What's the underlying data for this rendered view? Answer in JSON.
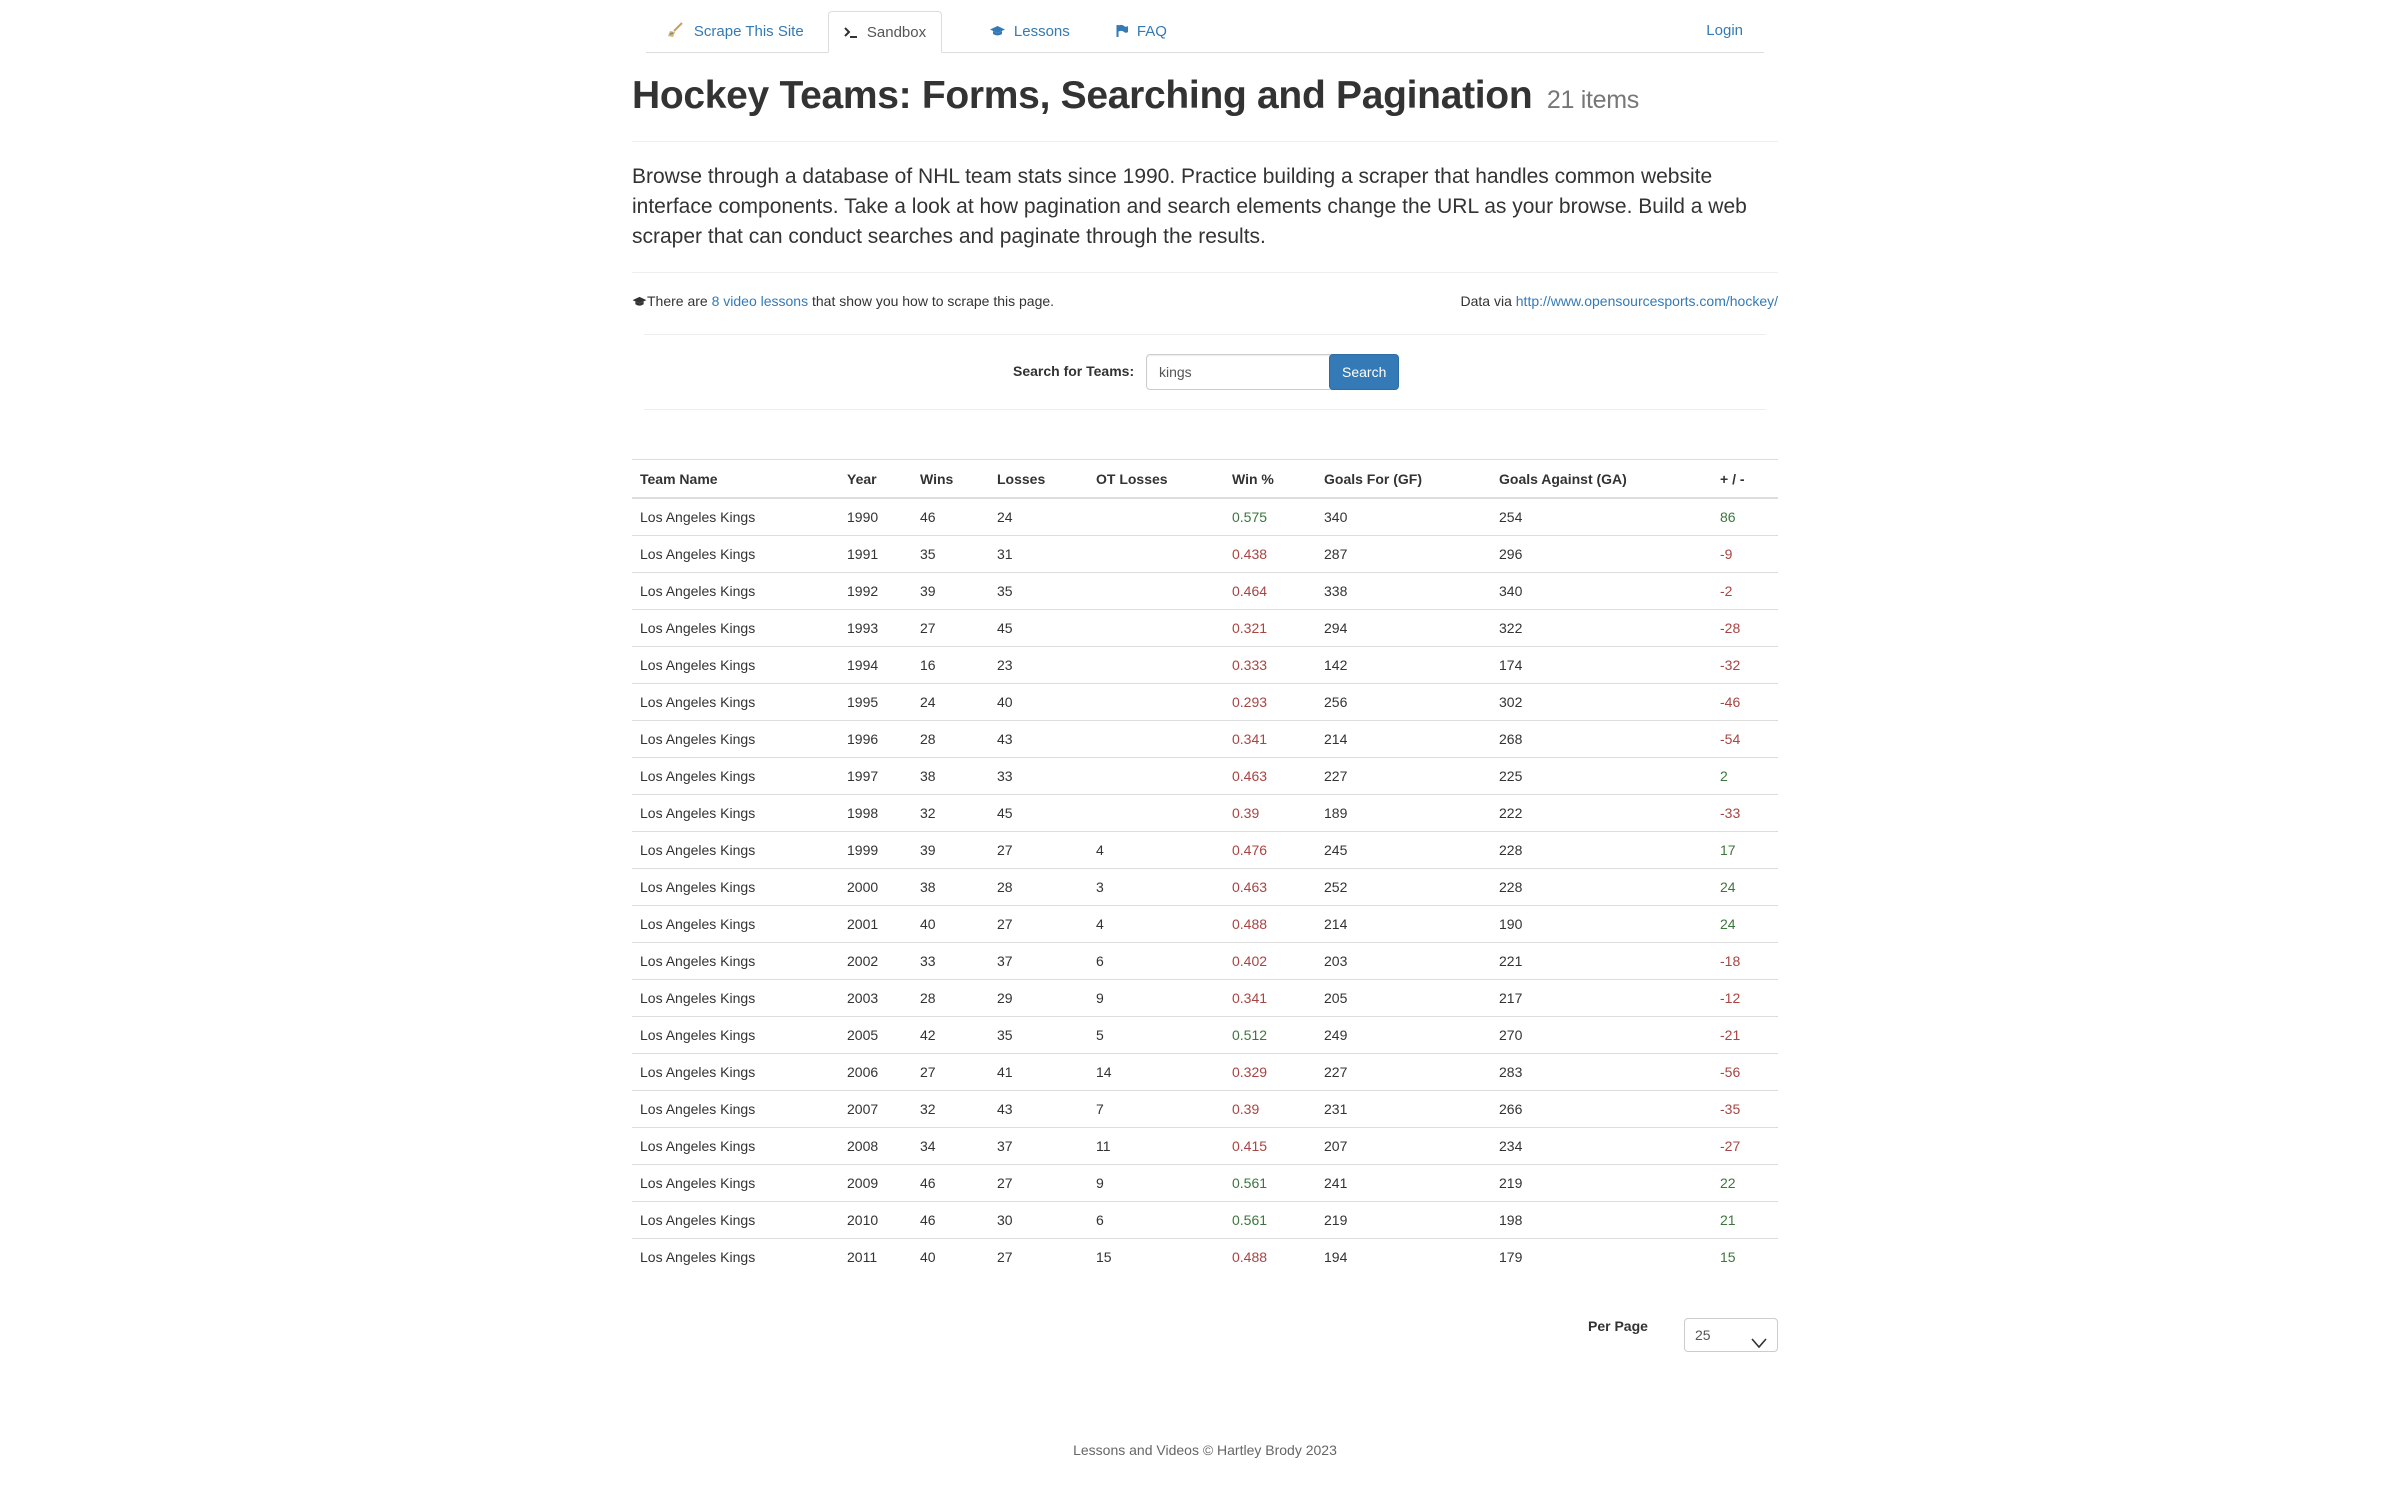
{
  "nav": {
    "items": [
      {
        "label": "Scrape This Site",
        "icon": "broom-icon"
      },
      {
        "label": "Sandbox",
        "icon": "terminal-icon"
      },
      {
        "label": "Lessons",
        "icon": "graduation-cap-icon"
      },
      {
        "label": "FAQ",
        "icon": "flag-icon"
      }
    ],
    "login": "Login"
  },
  "page": {
    "title": "Hockey Teams: Forms, Searching and Pagination",
    "count": "21 items",
    "lead": "Browse through a database of NHL team stats since 1990. Practice building a scraper that handles common website interface components. Take a look at how pagination and search elements change the URL as your browse. Build a web scraper that can conduct searches and paginate through the results.",
    "lessons_prefix": "There are ",
    "lessons_link": "8 video lessons",
    "lessons_suffix": " that show you how to scrape this page.",
    "data_via": "Data via ",
    "data_link": "http://www.opensourcesports.com/hockey/"
  },
  "search": {
    "label": "Search for Teams:",
    "value": "kings",
    "button": "Search"
  },
  "table": {
    "headers": [
      "Team Name",
      "Year",
      "Wins",
      "Losses",
      "OT Losses",
      "Win %",
      "Goals For (GF)",
      "Goals Against (GA)",
      "+ / -"
    ],
    "rows": [
      [
        "Los Angeles Kings",
        "1990",
        "46",
        "24",
        "",
        "0.575",
        "340",
        "254",
        "86"
      ],
      [
        "Los Angeles Kings",
        "1991",
        "35",
        "31",
        "",
        "0.438",
        "287",
        "296",
        "-9"
      ],
      [
        "Los Angeles Kings",
        "1992",
        "39",
        "35",
        "",
        "0.464",
        "338",
        "340",
        "-2"
      ],
      [
        "Los Angeles Kings",
        "1993",
        "27",
        "45",
        "",
        "0.321",
        "294",
        "322",
        "-28"
      ],
      [
        "Los Angeles Kings",
        "1994",
        "16",
        "23",
        "",
        "0.333",
        "142",
        "174",
        "-32"
      ],
      [
        "Los Angeles Kings",
        "1995",
        "24",
        "40",
        "",
        "0.293",
        "256",
        "302",
        "-46"
      ],
      [
        "Los Angeles Kings",
        "1996",
        "28",
        "43",
        "",
        "0.341",
        "214",
        "268",
        "-54"
      ],
      [
        "Los Angeles Kings",
        "1997",
        "38",
        "33",
        "",
        "0.463",
        "227",
        "225",
        "2"
      ],
      [
        "Los Angeles Kings",
        "1998",
        "32",
        "45",
        "",
        "0.39",
        "189",
        "222",
        "-33"
      ],
      [
        "Los Angeles Kings",
        "1999",
        "39",
        "27",
        "4",
        "0.476",
        "245",
        "228",
        "17"
      ],
      [
        "Los Angeles Kings",
        "2000",
        "38",
        "28",
        "3",
        "0.463",
        "252",
        "228",
        "24"
      ],
      [
        "Los Angeles Kings",
        "2001",
        "40",
        "27",
        "4",
        "0.488",
        "214",
        "190",
        "24"
      ],
      [
        "Los Angeles Kings",
        "2002",
        "33",
        "37",
        "6",
        "0.402",
        "203",
        "221",
        "-18"
      ],
      [
        "Los Angeles Kings",
        "2003",
        "28",
        "29",
        "9",
        "0.341",
        "205",
        "217",
        "-12"
      ],
      [
        "Los Angeles Kings",
        "2005",
        "42",
        "35",
        "5",
        "0.512",
        "249",
        "270",
        "-21"
      ],
      [
        "Los Angeles Kings",
        "2006",
        "27",
        "41",
        "14",
        "0.329",
        "227",
        "283",
        "-56"
      ],
      [
        "Los Angeles Kings",
        "2007",
        "32",
        "43",
        "7",
        "0.39",
        "231",
        "266",
        "-35"
      ],
      [
        "Los Angeles Kings",
        "2008",
        "34",
        "37",
        "11",
        "0.415",
        "207",
        "234",
        "-27"
      ],
      [
        "Los Angeles Kings",
        "2009",
        "46",
        "27",
        "9",
        "0.561",
        "241",
        "219",
        "22"
      ],
      [
        "Los Angeles Kings",
        "2010",
        "46",
        "30",
        "6",
        "0.561",
        "219",
        "198",
        "21"
      ],
      [
        "Los Angeles Kings",
        "2011",
        "40",
        "27",
        "15",
        "0.488",
        "194",
        "179",
        "15"
      ]
    ]
  },
  "pagination": {
    "per_page_label": "Per Page",
    "per_page_value": "25"
  },
  "footer": "Lessons and Videos © Hartley Brody 2023",
  "colors": {
    "link": "#337ab7",
    "positive": "#3c763d",
    "negative": "#a94442"
  }
}
